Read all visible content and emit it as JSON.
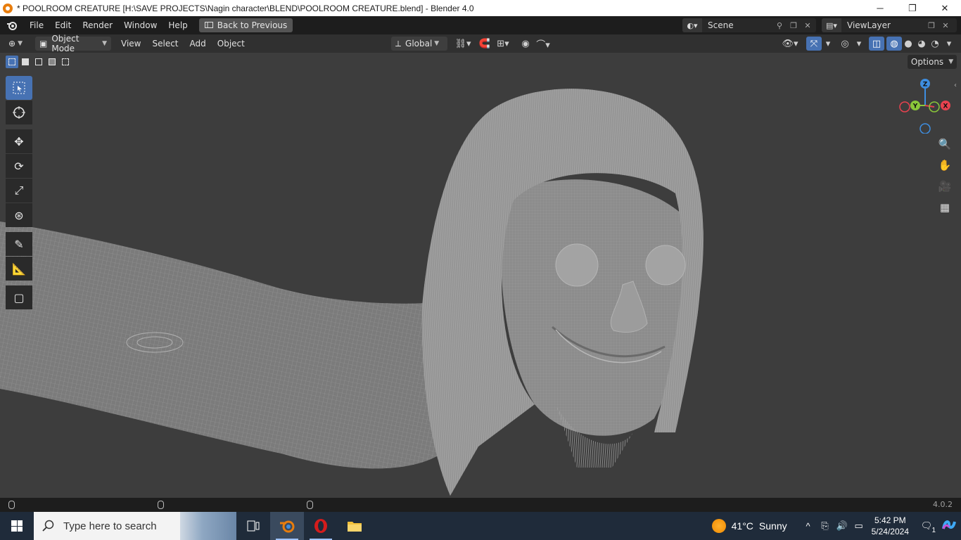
{
  "window": {
    "title": "* POOLROOM CREATURE [H:\\SAVE PROJECTS\\Nagin character\\BLEND\\POOLROOM CREATURE.blend] - Blender 4.0",
    "minimize": "─",
    "maximize": "❐",
    "close": "✕"
  },
  "menubar": {
    "items": [
      "File",
      "Edit",
      "Render",
      "Window",
      "Help"
    ],
    "back_button": "Back to Previous",
    "scene_name": "Scene",
    "view_layer": "ViewLayer"
  },
  "viewport_header": {
    "mode": "Object Mode",
    "menus": [
      "View",
      "Select",
      "Add",
      "Object"
    ],
    "transform_orientation": "Global",
    "options": "Options"
  },
  "toolbar": {
    "tools": [
      "select-box",
      "cursor",
      "move",
      "rotate",
      "scale",
      "transform",
      "annotate",
      "measure",
      "add-cube"
    ],
    "active_tool": "select-box"
  },
  "gizmo": {
    "z_label": "Z",
    "y_label": "Y",
    "x_label": "X",
    "colors": {
      "x": "#e8424f",
      "y": "#8ac73a",
      "z": "#3e8ee0"
    }
  },
  "statusbar": {
    "version": "4.0.2"
  },
  "taskbar": {
    "search_placeholder": "Type here to search",
    "weather_temp": "41°C",
    "weather_text": "Sunny",
    "time": "5:42 PM",
    "date": "5/24/2024",
    "notification_count": "1"
  },
  "accent_color": "#4772b3"
}
